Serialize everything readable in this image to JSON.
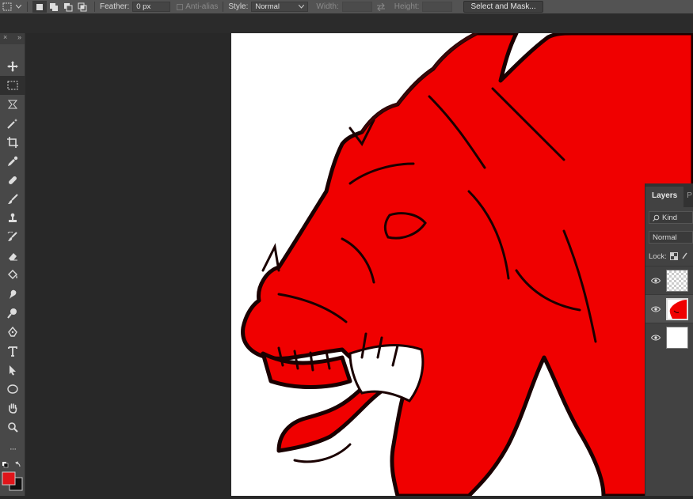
{
  "options_bar": {
    "feather_label": "Feather:",
    "feather_value": "0 px",
    "antialias_label": "Anti-alias",
    "style_label": "Style:",
    "style_value": "Normal",
    "width_label": "Width:",
    "height_label": "Height:",
    "select_mask_label": "Select and Mask..."
  },
  "toolbar": {
    "collapse_glyph": "×",
    "expand_glyph": "»",
    "more_glyph": "···",
    "tools": [
      {
        "name": "move-tool",
        "active": false
      },
      {
        "name": "rectangular-marquee-tool",
        "active": true
      },
      {
        "name": "lasso-tool",
        "active": false
      },
      {
        "name": "magic-wand-tool",
        "active": false
      },
      {
        "name": "crop-tool",
        "active": false
      },
      {
        "name": "eyedropper-tool",
        "active": false
      },
      {
        "name": "healing-brush-tool",
        "active": false
      },
      {
        "name": "brush-tool",
        "active": false
      },
      {
        "name": "clone-stamp-tool",
        "active": false
      },
      {
        "name": "history-brush-tool",
        "active": false
      },
      {
        "name": "eraser-tool",
        "active": false
      },
      {
        "name": "paint-bucket-tool",
        "active": false
      },
      {
        "name": "smudge-tool",
        "active": false
      },
      {
        "name": "dodge-tool",
        "active": false
      },
      {
        "name": "pen-tool",
        "active": false
      },
      {
        "name": "type-tool",
        "active": false
      },
      {
        "name": "path-selection-tool",
        "active": false
      },
      {
        "name": "ellipse-tool",
        "active": false
      },
      {
        "name": "hand-tool",
        "active": false
      },
      {
        "name": "zoom-tool",
        "active": false
      }
    ],
    "foreground_color": "#e0151a",
    "background_color": "#111111"
  },
  "layers_panel": {
    "tab_layers": "Layers",
    "tab_paths": "P",
    "kind_label": "Kind",
    "blend_mode": "Normal",
    "lock_label": "Lock:",
    "layers": [
      {
        "thumb": "transparent",
        "selected": false
      },
      {
        "thumb": "dragon",
        "selected": true
      },
      {
        "thumb": "white",
        "selected": false
      }
    ]
  },
  "colors": {
    "dragon_fill": "#f00000",
    "dragon_outline": "#1a0000",
    "canvas": "#ffffff"
  }
}
